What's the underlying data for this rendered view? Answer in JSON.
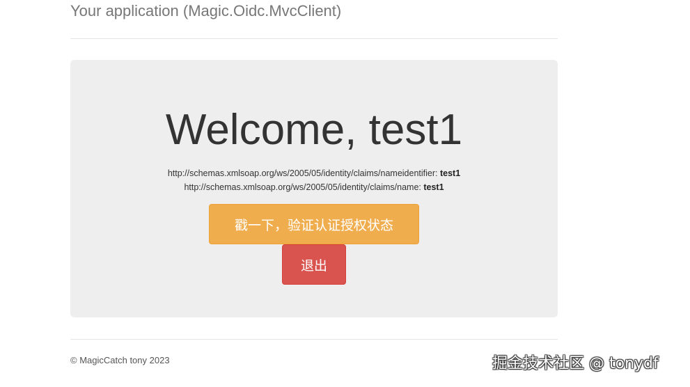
{
  "header": {
    "app_title": "Your application (Magic.Oidc.MvcClient)"
  },
  "main": {
    "welcome": "Welcome, test1",
    "claims": [
      {
        "type": "http://schemas.xmlsoap.org/ws/2005/05/identity/claims/nameidentifier:",
        "value": "test1"
      },
      {
        "type": "http://schemas.xmlsoap.org/ws/2005/05/identity/claims/name:",
        "value": "test1"
      }
    ],
    "check_button_label": "戳一下，验证认证授权状态",
    "logout_button_label": "退出"
  },
  "footer": {
    "copyright": "© MagicCatch tony 2023"
  },
  "watermark": {
    "text": "掘金技术社区 @ tonydf"
  },
  "colors": {
    "warning": "#f0ad4e",
    "danger": "#d9534f",
    "jumbotron_bg": "#eeeeee"
  }
}
